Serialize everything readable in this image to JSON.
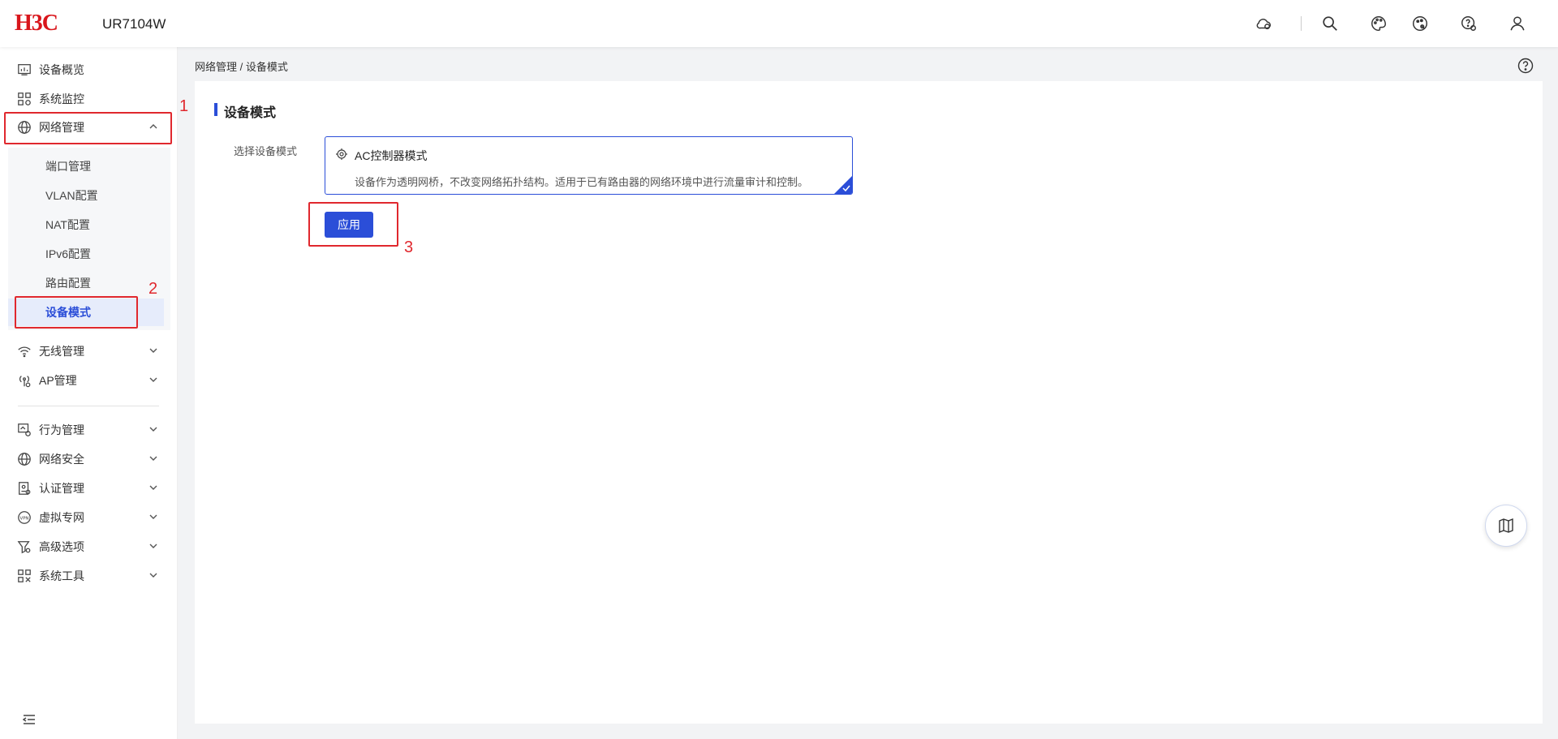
{
  "header": {
    "brand": "H3C",
    "model": "UR7104W",
    "brand_color": "#d9161c",
    "tools": [
      "cloud-icon",
      "search-icon",
      "palette-icon",
      "theme-icon",
      "help-settings-icon",
      "user-icon"
    ]
  },
  "sidebar": {
    "items": [
      {
        "label": "设备概览",
        "icon": "dashboard-icon"
      },
      {
        "label": "系统监控",
        "icon": "monitor-icon"
      },
      {
        "label": "网络管理",
        "icon": "globe-icon",
        "expanded": true
      },
      {
        "label": "无线管理",
        "icon": "wifi-icon"
      },
      {
        "label": "AP管理",
        "icon": "ap-icon"
      },
      {
        "label": "行为管理",
        "icon": "behavior-icon"
      },
      {
        "label": "网络安全",
        "icon": "security-globe-icon"
      },
      {
        "label": "认证管理",
        "icon": "auth-icon"
      },
      {
        "label": "虚拟专网",
        "icon": "vpn-icon"
      },
      {
        "label": "高级选项",
        "icon": "filter-icon"
      },
      {
        "label": "系统工具",
        "icon": "tools-icon"
      }
    ],
    "sub_items": [
      {
        "label": "端口管理"
      },
      {
        "label": "VLAN配置"
      },
      {
        "label": "NAT配置"
      },
      {
        "label": "IPv6配置"
      },
      {
        "label": "路由配置"
      },
      {
        "label": "设备模式",
        "active": true
      }
    ]
  },
  "breadcrumb": "网络管理 / 设备模式",
  "section_title": "设备模式",
  "field_label": "选择设备模式",
  "mode_card": {
    "title": "AC控制器模式",
    "description": "设备作为透明网桥，不改变网络拓扑结构。适用于已有路由器的网络环境中进行流量审计和控制。",
    "selected": true
  },
  "apply_label": "应用",
  "annotations": [
    "1",
    "2",
    "3"
  ],
  "accent_color": "#2b4ed8",
  "annotation_color": "#e0282e"
}
